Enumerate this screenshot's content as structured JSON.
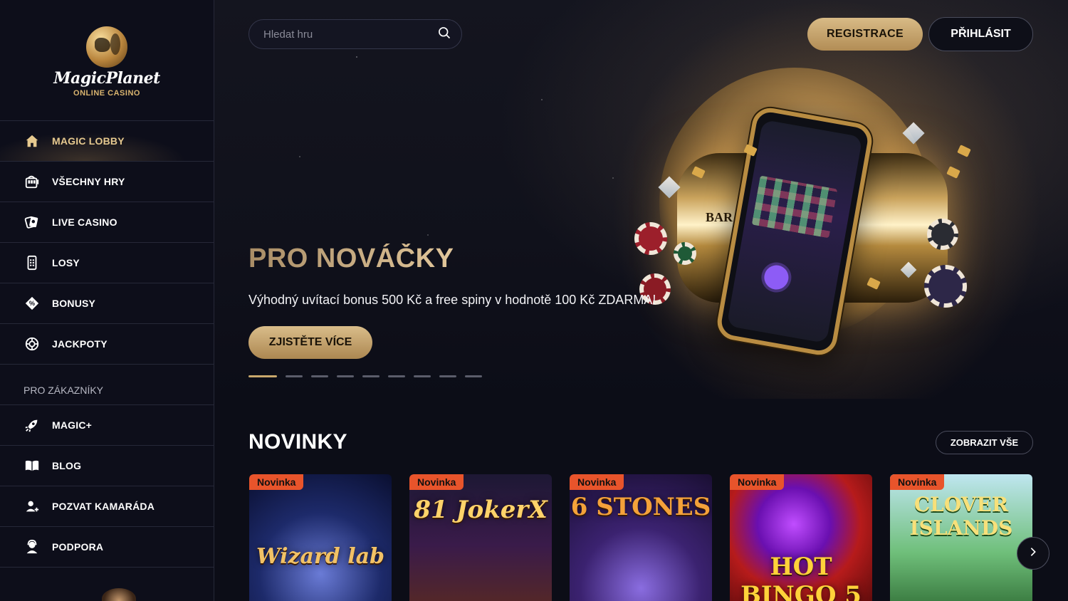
{
  "brand": {
    "name": "MagicPlanet",
    "tagline": "ONLINE CASINO"
  },
  "sidebar": {
    "items": [
      {
        "label": "MAGIC LOBBY",
        "icon": "home-icon",
        "active": true
      },
      {
        "label": "VŠECHNY HRY",
        "icon": "slot-machine-icon"
      },
      {
        "label": "LIVE CASINO",
        "icon": "cards-icon"
      },
      {
        "label": "LOSY",
        "icon": "ticket-icon"
      },
      {
        "label": "BONUSY",
        "icon": "bonus-tag-icon"
      },
      {
        "label": "JACKPOTY",
        "icon": "chip-icon"
      }
    ],
    "section_label": "PRO ZÁKAZNÍKY",
    "customer_items": [
      {
        "label": "MAGIC+",
        "icon": "rocket-icon"
      },
      {
        "label": "BLOG",
        "icon": "book-icon"
      },
      {
        "label": "POZVAT KAMARÁDA",
        "icon": "add-user-icon"
      },
      {
        "label": "PODPORA",
        "icon": "support-agent-icon"
      }
    ]
  },
  "header": {
    "search_placeholder": "Hledat hru",
    "register_label": "REGISTRACE",
    "login_label": "PŘIHLÁSIT"
  },
  "hero": {
    "title": "PRO NOVÁČKY",
    "text": "Výhodný uvítací bonus 500 Kč a free spiny v hodnotě 100 Kč ZDARMA!",
    "cta_label": "ZJISTĚTE VÍCE",
    "slide_count": 9,
    "active_slide": 1
  },
  "novinky": {
    "title": "NOVINKY",
    "show_all_label": "ZOBRAZIT VŠE",
    "games": [
      {
        "badge": "Novinka",
        "name": "Wizard lab"
      },
      {
        "badge": "Novinka",
        "name": "81 JokerX"
      },
      {
        "badge": "Novinka",
        "name": "6 STONES"
      },
      {
        "badge": "Novinka",
        "name": "HOT BINGO 5"
      },
      {
        "badge": "Novinka",
        "name": "CLOVER ISLANDS"
      }
    ]
  },
  "colors": {
    "accent_gold": "#c9a86c",
    "badge_orange": "#e8542b",
    "background": "#0c0d17"
  }
}
